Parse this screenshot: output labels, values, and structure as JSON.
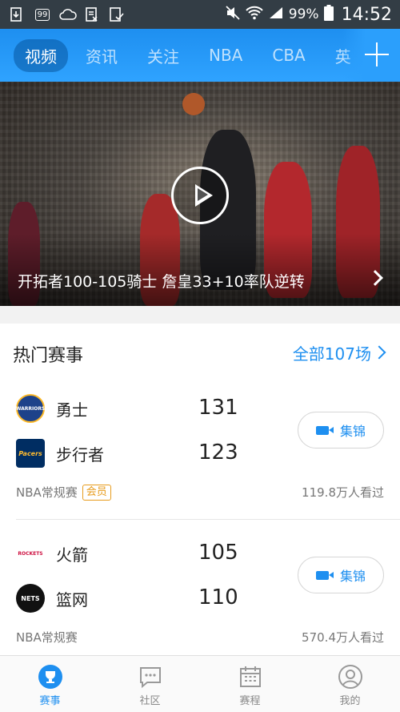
{
  "status_bar": {
    "battery_text": "99%",
    "time": "14:52",
    "notification_badge": "99"
  },
  "top_nav": {
    "tabs": [
      {
        "label": "视频",
        "active": true
      },
      {
        "label": "资讯",
        "active": false
      },
      {
        "label": "关注",
        "active": false
      },
      {
        "label": "NBA",
        "active": false
      },
      {
        "label": "CBA",
        "active": false
      },
      {
        "label": "英",
        "active": false
      }
    ],
    "add_icon": "plus-icon"
  },
  "hero": {
    "caption": "开拓者100-105骑士 詹皇33+10率队逆转"
  },
  "hot_matches": {
    "title": "热门赛事",
    "more_label": "全部107场",
    "matches": [
      {
        "teams": [
          {
            "name": "勇士",
            "score": "131",
            "logo_text": "WARRIORS",
            "logo_color": "#1d428a"
          },
          {
            "name": "步行者",
            "score": "123",
            "logo_text": "Pacers",
            "logo_color": "#002d62"
          }
        ],
        "highlight_label": "集锦",
        "league": "NBA常规赛",
        "badge": "会员",
        "viewers": "119.8万人看过"
      },
      {
        "teams": [
          {
            "name": "火箭",
            "score": "105",
            "logo_text": "ROCKETS",
            "logo_color": "#ce1141"
          },
          {
            "name": "篮网",
            "score": "110",
            "logo_text": "NETS",
            "logo_color": "#111111"
          }
        ],
        "highlight_label": "集锦",
        "league": "NBA常规赛",
        "badge": "",
        "viewers": "570.4万人看过"
      }
    ]
  },
  "bottom_nav": {
    "items": [
      {
        "label": "赛事",
        "icon": "trophy-icon",
        "active": true
      },
      {
        "label": "社区",
        "icon": "chat-bubble-icon",
        "active": false
      },
      {
        "label": "赛程",
        "icon": "calendar-icon",
        "active": false
      },
      {
        "label": "我的",
        "icon": "profile-icon",
        "active": false
      }
    ]
  },
  "colors": {
    "accent": "#1e8ff0",
    "vip": "#e79b1c",
    "status_bar": "#333d45"
  }
}
